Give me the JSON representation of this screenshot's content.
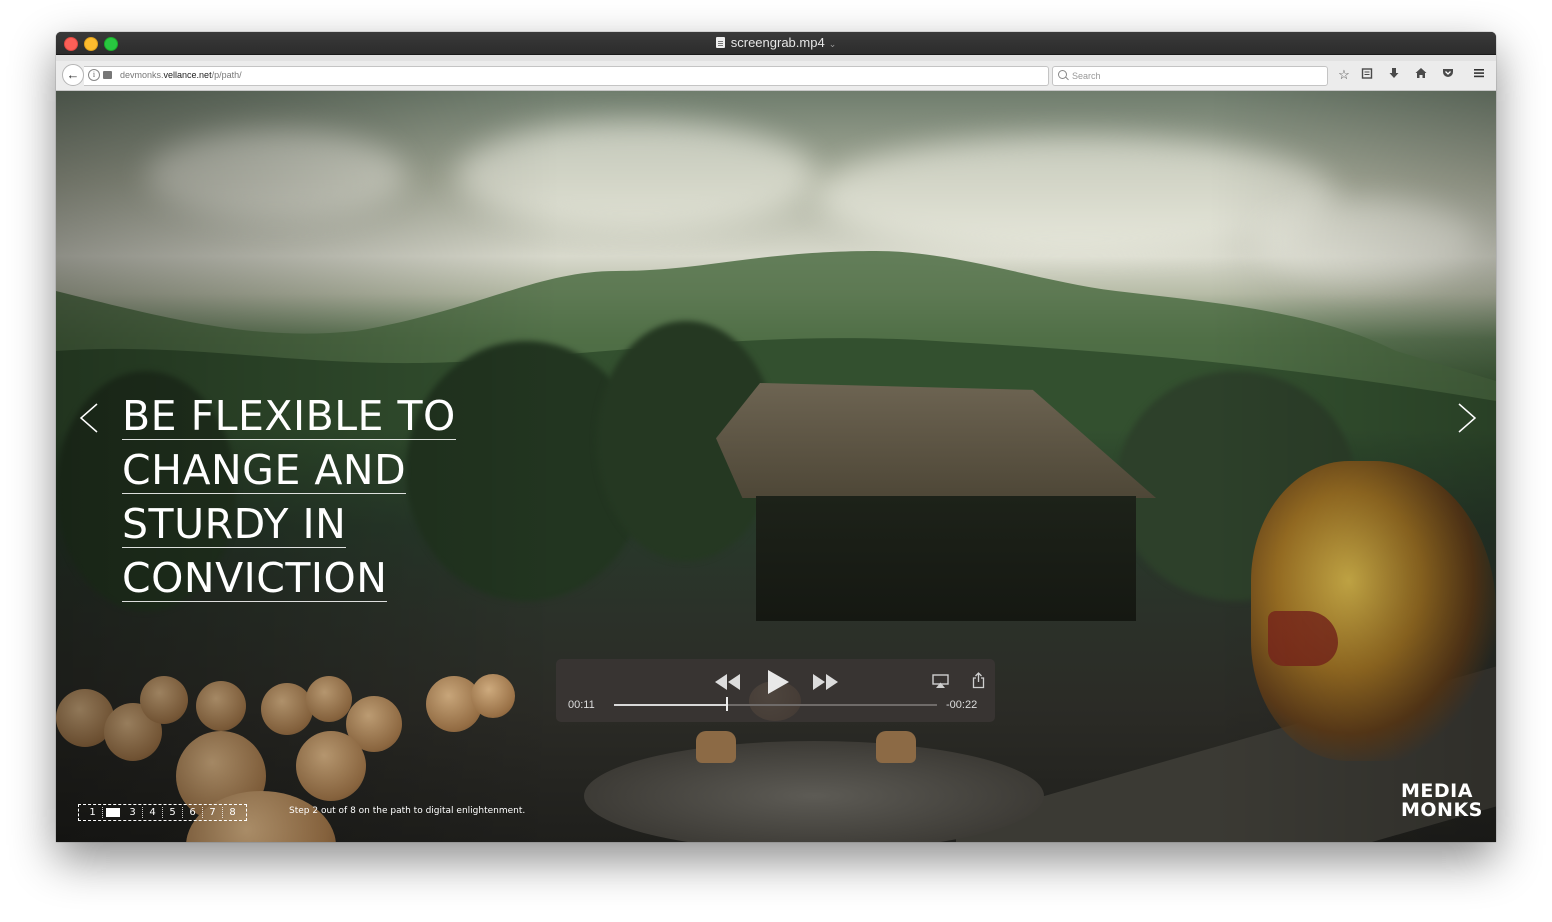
{
  "window": {
    "title": "screengrab.mp4",
    "title_chevron": "⌄"
  },
  "navbar": {
    "url_host_prefix": "devmonks.",
    "url_host": "vellance.net",
    "url_path": "/p/path/",
    "search_placeholder": "Search",
    "icons": [
      "back-icon",
      "info-icon",
      "lock-icon",
      "reload-icon",
      "search-icon",
      "star-icon",
      "reading-list-icon",
      "download-icon",
      "home-icon",
      "pocket-icon",
      "menu-icon"
    ]
  },
  "page": {
    "headline_lines": [
      "BE FLEXIBLE TO",
      "CHANGE AND",
      "STURDY IN",
      "CONVICTION"
    ],
    "pager": {
      "items": [
        "1",
        "2",
        "3",
        "4",
        "5",
        "6",
        "7",
        "8"
      ],
      "active_index": 1
    },
    "step_caption": "Step 2 out of 8 on the path to digital enlightenment.",
    "brand_line1": "MEDIA",
    "brand_line2": "MONKS"
  },
  "player": {
    "current_time": "00:11",
    "remaining_time": "-00:22",
    "progress": 0.35,
    "icons": [
      "rewind-icon",
      "play-icon",
      "fast-forward-icon",
      "airplay-icon",
      "share-icon"
    ]
  },
  "colors": {
    "accent_white": "#ffffff",
    "player_bg": "#3a3634",
    "titlebar_bg": "#2c2c2c",
    "navbar_bg": "#ececec"
  }
}
